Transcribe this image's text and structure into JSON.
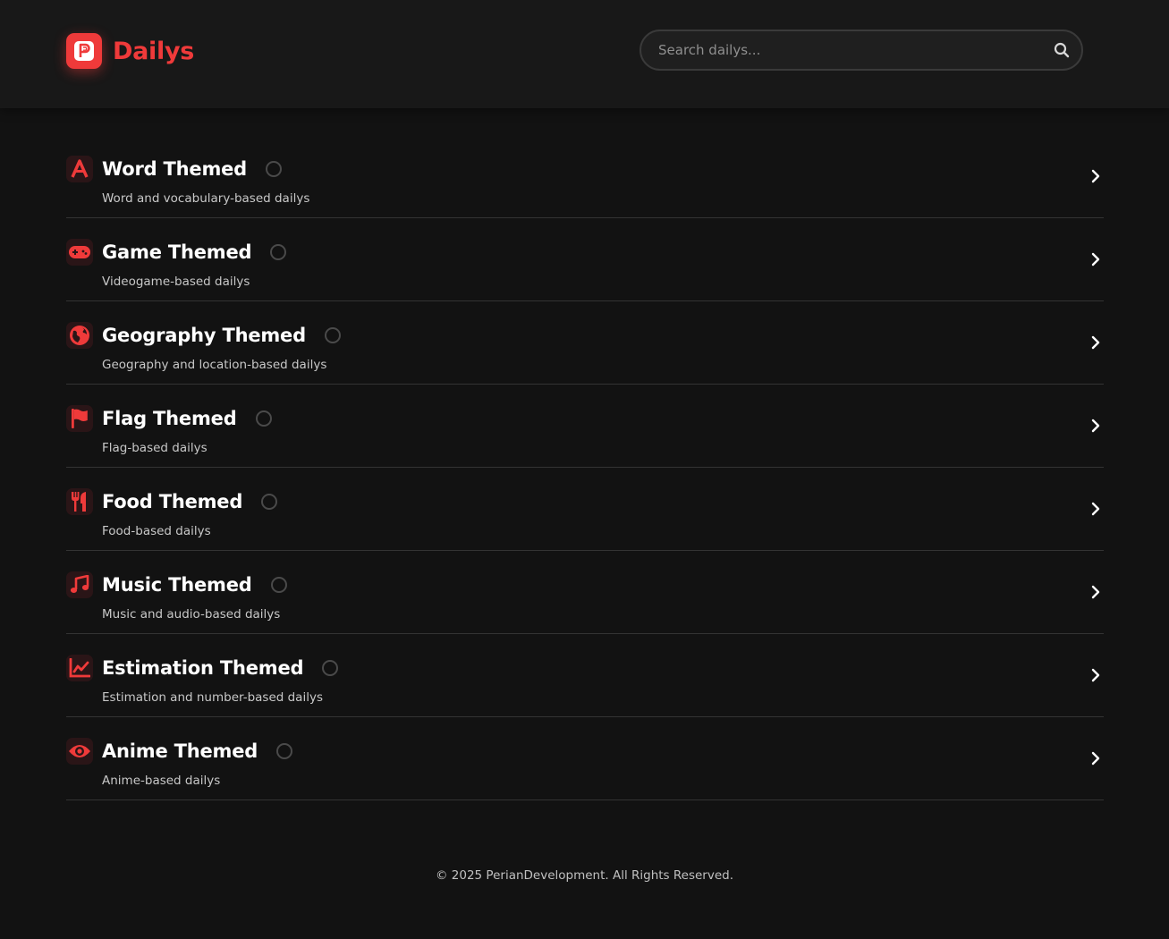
{
  "brand": {
    "logo_letter": "P",
    "name": "Dailys"
  },
  "search": {
    "placeholder": "Search dailys...",
    "value": ""
  },
  "colors": {
    "accent": "#ef3a3a",
    "background": "#121212",
    "header": "#181818"
  },
  "categories": [
    {
      "title": "Word Themed",
      "description": "Word and vocabulary-based dailys",
      "icon": "letter-a-icon"
    },
    {
      "title": "Game Themed",
      "description": "Videogame-based dailys",
      "icon": "gamepad-icon"
    },
    {
      "title": "Geography Themed",
      "description": "Geography and location-based dailys",
      "icon": "globe-icon"
    },
    {
      "title": "Flag Themed",
      "description": "Flag-based dailys",
      "icon": "flag-icon"
    },
    {
      "title": "Food Themed",
      "description": "Food-based dailys",
      "icon": "utensils-icon"
    },
    {
      "title": "Music Themed",
      "description": "Music and audio-based dailys",
      "icon": "music-note-icon"
    },
    {
      "title": "Estimation Themed",
      "description": "Estimation and number-based dailys",
      "icon": "chart-line-icon"
    },
    {
      "title": "Anime Themed",
      "description": "Anime-based dailys",
      "icon": "eye-icon"
    }
  ],
  "footer": {
    "text": "© 2025 PerianDevelopment. All Rights Reserved."
  }
}
